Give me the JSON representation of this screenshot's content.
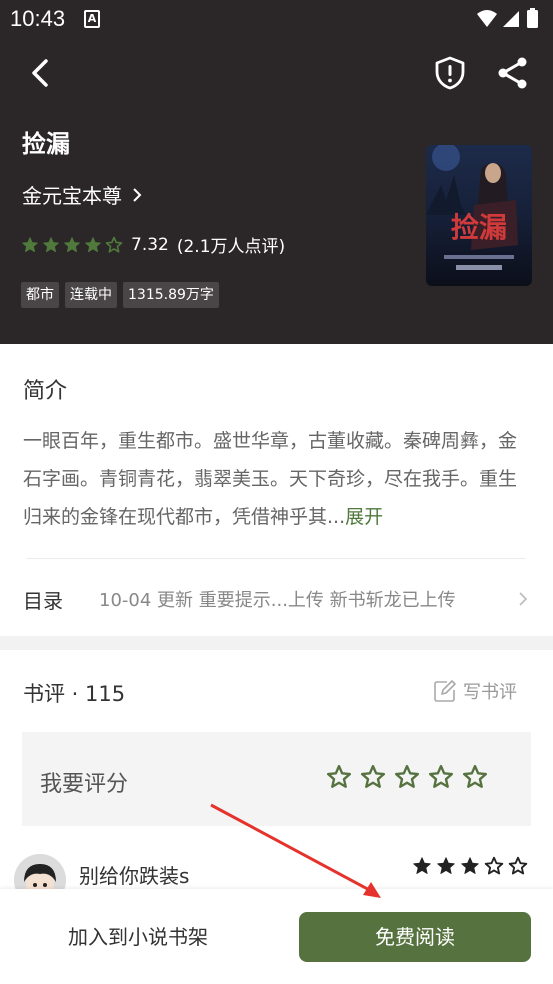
{
  "status_bar": {
    "time": "10:43",
    "notif_icon_letter": "A"
  },
  "header": {
    "back_icon": "chevron-left-icon",
    "report_icon": "shield-alert-icon",
    "share_icon": "share-icon"
  },
  "book": {
    "title": "捡漏",
    "author": "金元宝本尊",
    "rating": 7.32,
    "rating_text": "7.32",
    "rating_count": "(2.1万人点评)",
    "stars_filled": 4,
    "stars_total": 5,
    "tags": [
      "都市",
      "连载中",
      "1315.89万字"
    ],
    "cover_title": "捡漏"
  },
  "intro": {
    "heading": "简介",
    "text": "一眼百年，重生都市。盛世华章，古董收藏。秦碑周彝，金石字画。青铜青花，翡翠美玉。天下奇珍，尽在我手。重生归来的金锋在现代都市，凭借神乎其...",
    "expand": "展开"
  },
  "toc": {
    "label": "目录",
    "info": "10-04  更新  重要提示...上传 新书斩龙已上传"
  },
  "reviews": {
    "heading": "书评 · 115",
    "write": "写书评",
    "rate_label": "我要评分",
    "comment": {
      "user": "别给你跌装s",
      "stars_filled": 3
    }
  },
  "bottom_bar": {
    "add_shelf": "加入到小说书架",
    "read_free": "免费阅读"
  },
  "colors": {
    "header_bg": "#2b2627",
    "accent": "#55723f",
    "star_green": "#4f7a3c"
  }
}
